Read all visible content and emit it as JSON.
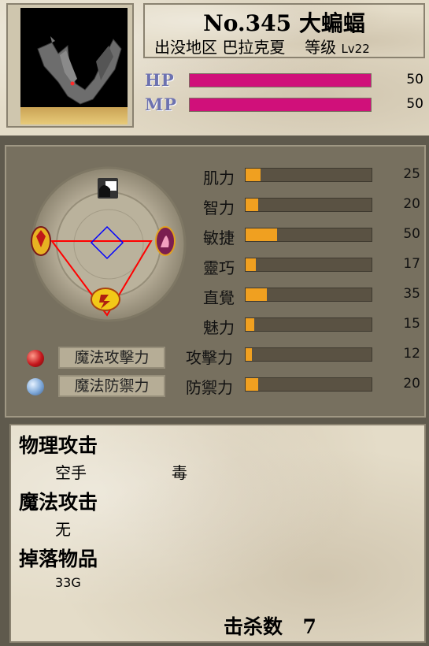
{
  "monster": {
    "title": "No.345 大蝙蝠",
    "zone_label": "出没地区",
    "zone_name": "巴拉克夏",
    "level_label": "等级",
    "level_value": "Lv22"
  },
  "bars": {
    "hp": {
      "label": "HP",
      "value": "50",
      "fill": 1.0
    },
    "mp": {
      "label": "MP",
      "value": "50",
      "fill": 1.0
    }
  },
  "stats": [
    {
      "label": "肌力",
      "value": "25",
      "fill": 0.12
    },
    {
      "label": "智力",
      "value": "20",
      "fill": 0.1
    },
    {
      "label": "敏捷",
      "value": "50",
      "fill": 0.25
    },
    {
      "label": "靈巧",
      "value": "17",
      "fill": 0.08
    },
    {
      "label": "直覺",
      "value": "35",
      "fill": 0.17
    },
    {
      "label": "魅力",
      "value": "15",
      "fill": 0.07
    },
    {
      "label": "攻擊力",
      "value": "12",
      "fill": 0.05
    },
    {
      "label": "防禦力",
      "value": "20",
      "fill": 0.1
    }
  ],
  "magic": {
    "attack_label": "魔法攻擊力",
    "defense_label": "魔法防禦力"
  },
  "details": {
    "physical_title": "物理攻击",
    "physical_items": [
      "空手",
      "毒"
    ],
    "magic_title": "魔法攻击",
    "magic_items": [
      "无"
    ],
    "drop_title": "掉落物品",
    "drop_items": [
      "33G"
    ],
    "kill_label": "击杀数",
    "kill_value": "7"
  },
  "colors": {
    "hp_fill": "#d0107a",
    "mp_fill": "#d0107a",
    "stat_fill": "#f0a020",
    "triangle": "#ff0000",
    "diamond": "#0000ff"
  },
  "icons": [
    "bat-portrait",
    "fist-icon",
    "shield-icon",
    "flame-icon",
    "lightning-icon",
    "red-orb-icon",
    "blue-orb-icon"
  ]
}
